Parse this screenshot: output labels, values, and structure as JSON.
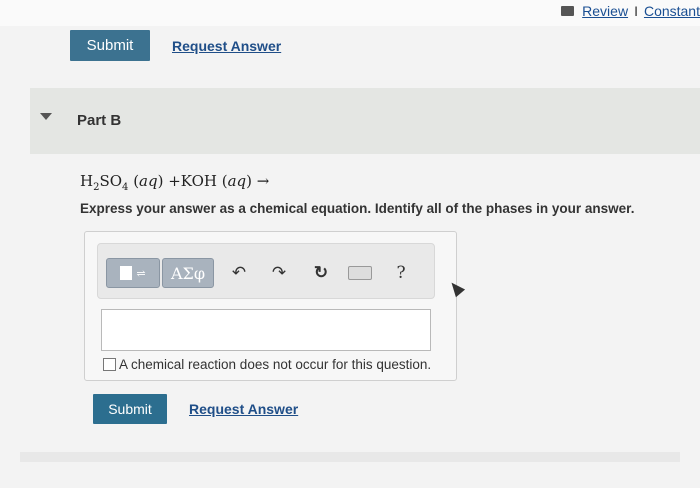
{
  "header": {
    "review_label": "Review",
    "separator": "I",
    "constants_label": "Constant"
  },
  "top_actions": {
    "submit_label": "Submit",
    "request_label": "Request Answer"
  },
  "part": {
    "title": "Part B"
  },
  "question": {
    "reactant1_base": "H",
    "reactant1_sub1": "2",
    "reactant1_mid": "SO",
    "reactant1_sub2": "4",
    "phase1": "aq",
    "plus": "+",
    "reactant2": "KOH",
    "phase2": "aq",
    "arrow": "→",
    "instructions": "Express your answer as a chemical equation. Identify all of the phases in your answer."
  },
  "toolbar": {
    "greek_label": "ΑΣφ",
    "undo_icon": "↶",
    "redo_icon": "↷",
    "reset_icon": "↻",
    "help_label": "?"
  },
  "answer": {
    "value": "",
    "no_reaction_label": "A chemical reaction does not occur for this question."
  },
  "bottom_actions": {
    "submit_label": "Submit",
    "request_label": "Request Answer"
  },
  "colors": {
    "submit_bg": "#2c6e8f",
    "link": "#1f4e88",
    "part_header_bg": "#e4e6e3"
  }
}
